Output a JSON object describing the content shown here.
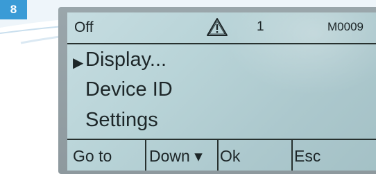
{
  "step_badge": "8",
  "status_bar": {
    "mode": "Off",
    "warning_icon": "warning-triangle-icon",
    "count": "1",
    "code": "M0009"
  },
  "menu": {
    "items": [
      {
        "label": "Display...",
        "selected": true
      },
      {
        "label": "Device ID",
        "selected": false
      },
      {
        "label": "Settings",
        "selected": false
      }
    ]
  },
  "softkeys": {
    "goto": "Go to",
    "down": "Down ▾",
    "ok": "Ok",
    "esc": "Esc"
  },
  "colors": {
    "badge": "#3a9bd6",
    "lcd_background": "#bcd6da",
    "lcd_text": "#1d2628",
    "frame": "#959fa4"
  }
}
